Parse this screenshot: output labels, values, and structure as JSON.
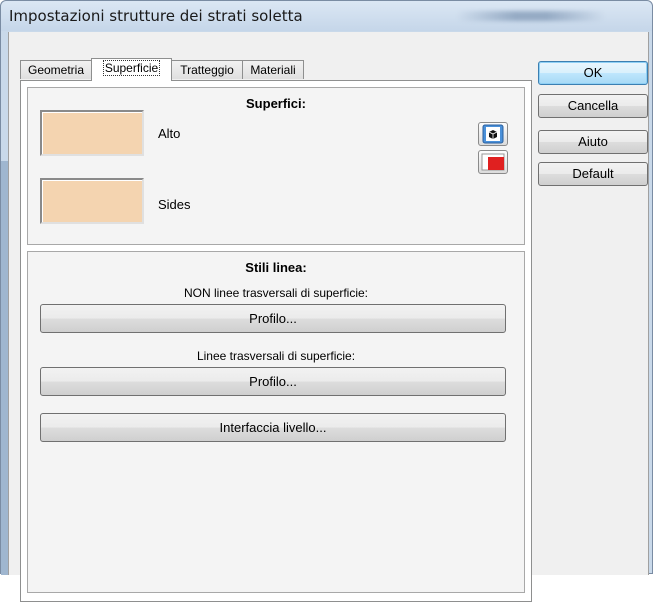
{
  "window": {
    "title": "Impostazioni strutture dei strati soletta"
  },
  "tabs": [
    {
      "label": "Geometria",
      "active": false
    },
    {
      "label": "Superficie",
      "active": true
    },
    {
      "label": "Tratteggio",
      "active": false
    },
    {
      "label": "Materiali",
      "active": false
    }
  ],
  "surfaces": {
    "title": "Superfici:",
    "items": [
      {
        "label": "Alto",
        "color": "#f4d4b0"
      },
      {
        "label": "Sides",
        "color": "#f4d4b0"
      }
    ],
    "icons": [
      "3d-box-icon",
      "red-square-icon"
    ]
  },
  "line_styles": {
    "title": "Stili linea:",
    "non_cross_label": "NON linee trasversali di superficie:",
    "non_cross_button": "Profilo...",
    "cross_label": "Linee trasversali di superficie:",
    "cross_button": "Profilo...",
    "interface_button": "Interfaccia livello..."
  },
  "buttons": {
    "ok": "OK",
    "cancel": "Cancella",
    "help": "Aiuto",
    "default": "Default"
  },
  "colors": {
    "accent_focus": "#3c7fb1",
    "swatch": "#f4d4b0",
    "red_icon": "#e02020"
  }
}
